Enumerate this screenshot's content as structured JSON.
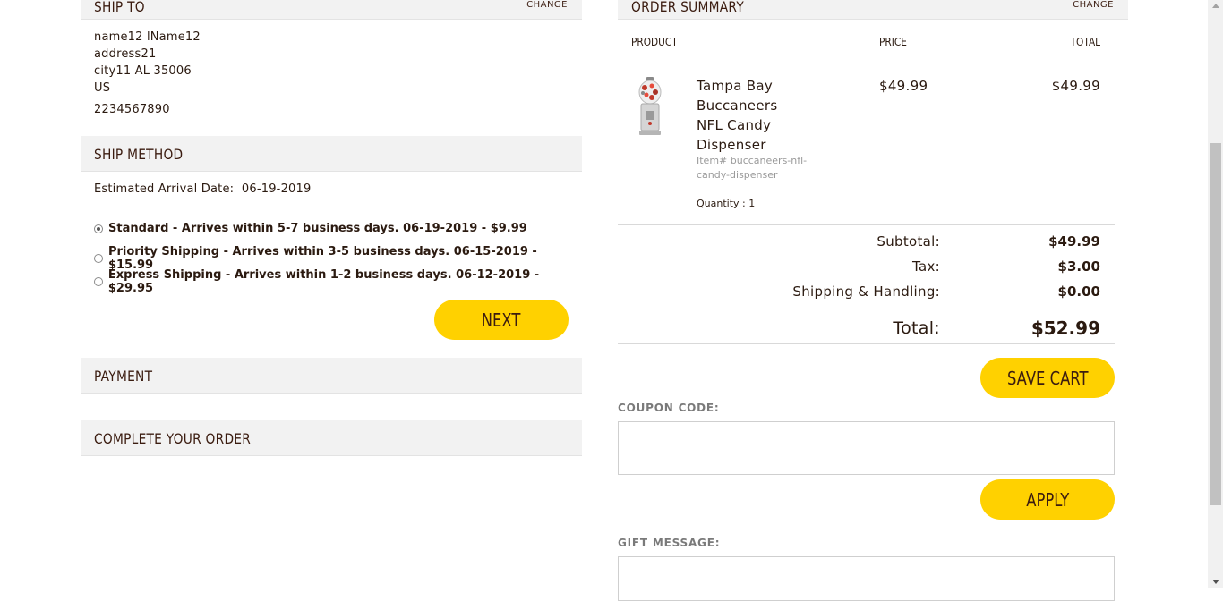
{
  "ship_to": {
    "title": "SHIP TO",
    "change_label": "CHANGE",
    "lines": [
      "name12 lName12",
      "address21",
      "city11 AL 35006",
      "US"
    ],
    "phone": "2234567890"
  },
  "ship_method": {
    "title": "SHIP METHOD",
    "estimated_label": "Estimated Arrival Date:",
    "estimated_date": "06-19-2019",
    "options": [
      {
        "label": "Standard - Arrives within 5-7 business days. 06-19-2019 - $9.99",
        "selected": true
      },
      {
        "label": "Priority Shipping - Arrives within 3-5 business days. 06-15-2019 - $15.99",
        "selected": false
      },
      {
        "label": "Express Shipping - Arrives within 1-2 business days. 06-12-2019 - $29.95",
        "selected": false
      }
    ],
    "next_label": "NEXT"
  },
  "payment": {
    "title": "PAYMENT"
  },
  "complete": {
    "title": "COMPLETE YOUR ORDER"
  },
  "order_summary": {
    "title": "ORDER SUMMARY",
    "change_label": "CHANGE",
    "columns": [
      "PRODUCT",
      "PRICE",
      "TOTAL"
    ],
    "item": {
      "name": "Tampa Bay Buccaneers NFL Candy Dispenser",
      "sku": "Item# buccaneers-nfl-candy-dispenser",
      "quantity": "Quantity : 1",
      "price": "$49.99",
      "total": "$49.99",
      "image_icon": "candy-dispenser-image"
    },
    "subtotal_label": "Subtotal:",
    "subtotal": "$49.99",
    "tax_label": "Tax:",
    "tax": "$3.00",
    "shipping_label": "Shipping & Handling:",
    "shipping": "$0.00",
    "total_label": "Total:",
    "total": "$52.99",
    "save_cart_label": "SAVE CART",
    "coupon_label": "COUPON CODE:",
    "coupon_value": "",
    "apply_label": "APPLY",
    "gift_label": "GIFT MESSAGE:",
    "gift_value": ""
  },
  "colors": {
    "accent": "#ffd100",
    "text": "#3b1c10",
    "section_bg": "#f2f2f2"
  }
}
